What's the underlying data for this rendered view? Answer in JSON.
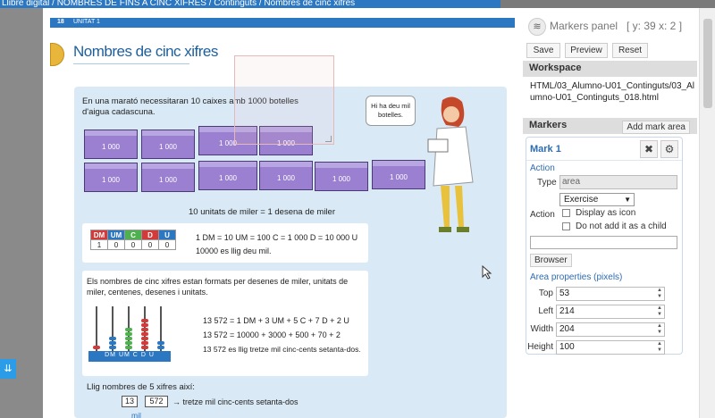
{
  "breadcrumb": "Llibre digital / NOMBRES DE FINS A CINC XIFRES / Continguts / Nombres de cinc xifres",
  "page": {
    "number": "18",
    "unit": "UNITAT 1",
    "title": "Nombres de cinc xifres",
    "intro": "En una marató necessitaran 10 caixes amb 1000 botelles d'aigua cadascuna.",
    "cube_label": "1 000",
    "bubble": "Hi ha deu mil botelles.",
    "ten_units": "10 unitats de miler = 1 desena de miler",
    "table_headers": [
      "DM",
      "UM",
      "C",
      "D",
      "U"
    ],
    "table_values": [
      "1",
      "0",
      "0",
      "0",
      "0"
    ],
    "table_colors": [
      "#d33a3a",
      "#2b77c2",
      "#4fb04f",
      "#d33a3a",
      "#2b77c2"
    ],
    "equiv_line": "1 DM = 10 UM = 100 C = 1 000 D = 10 000 U",
    "equiv_read": "10000 es llig deu mil.",
    "bullet": "Els nombres de cinc xifres estan formats per desenes de miler, unitats de miler, centenes, desenes i unitats.",
    "decomp1": "13 572 = 1 DM + 3 UM + 5 C + 7 D + 2 U",
    "decomp2": "13 572 = 10000 + 3000 + 500 + 70 + 2",
    "decomp3": "13 572 es llig tretze mil cinc-cents setanta-dos.",
    "abacus_labels": [
      "DM",
      "UM",
      "C",
      "D",
      "U"
    ],
    "read_title": "Llig nombres de 5 xifres així:",
    "read_box1": "13",
    "read_box2": "572",
    "read_result": "→ tretze mil cinc-cents setanta-dos",
    "read_mil": "mil"
  },
  "markers_panel": {
    "title": "Markers panel",
    "coords": "[ y: 39 x: 2 ]",
    "save": "Save",
    "preview": "Preview",
    "reset": "Reset",
    "workspace_label": "Workspace",
    "workspace_path": "HTML/03_Alumno-U01_Continguts/03_Alumno-U01_Continguts_018.html",
    "markers_label": "Markers",
    "add_mark": "Add mark area",
    "mark": {
      "name": "Mark 1",
      "action_label": "Action",
      "type_label": "Type",
      "type_value": "area",
      "action_field_label": "Action",
      "action_select": "Exercise",
      "display_as_icon": "Display as icon",
      "do_not_add_child": "Do not add it as a child",
      "browse": "Browser",
      "area_props": "Area properties (pixels)",
      "top_label": "Top",
      "top": "53",
      "left_label": "Left",
      "left": "214",
      "width_label": "Width",
      "width": "204",
      "height_label": "Height",
      "height": "100"
    }
  }
}
